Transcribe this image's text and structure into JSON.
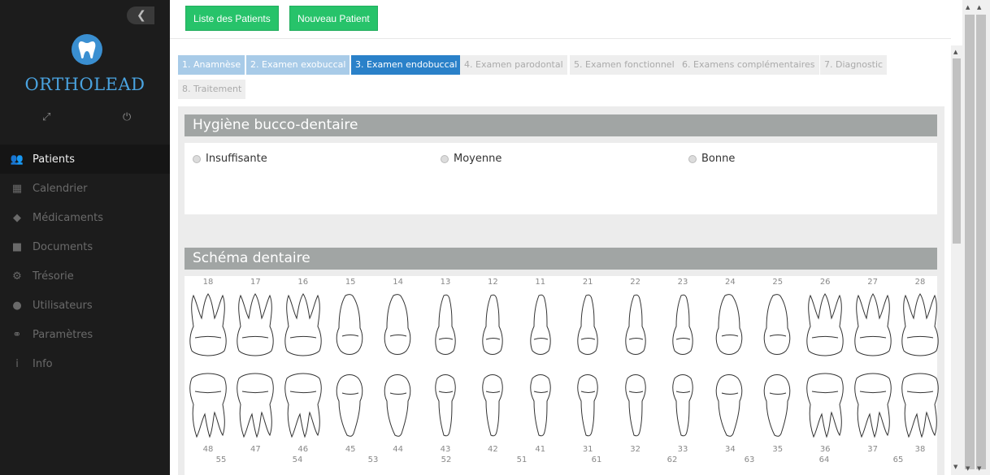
{
  "sidebar": {
    "brand": "ORTHOLEAD",
    "items": [
      {
        "label": "Patients",
        "icon": "patients-icon",
        "glyph": "👥",
        "active": true
      },
      {
        "label": "Calendrier",
        "icon": "calendar-icon",
        "glyph": "▦",
        "active": false
      },
      {
        "label": "Médicaments",
        "icon": "pill-icon",
        "glyph": "◆",
        "active": false
      },
      {
        "label": "Documents",
        "icon": "document-icon",
        "glyph": "■",
        "active": false
      },
      {
        "label": "Trésorie",
        "icon": "treasury-icon",
        "glyph": "⚙",
        "active": false
      },
      {
        "label": "Utilisateurs",
        "icon": "user-icon",
        "glyph": "●",
        "active": false
      },
      {
        "label": "Paramètres",
        "icon": "settings-icon",
        "glyph": "⚭",
        "active": false
      },
      {
        "label": "Info",
        "icon": "info-icon",
        "glyph": "i",
        "active": false
      }
    ]
  },
  "toolbar": {
    "patients_list_label": "Liste des Patients",
    "new_patient_label": "Nouveau Patient"
  },
  "steps": [
    {
      "label": "1. Anamnèse",
      "state": "done"
    },
    {
      "label": "2. Examen exobuccal",
      "state": "done"
    },
    {
      "label": "3. Examen endobuccal",
      "state": "current"
    },
    {
      "label": "4. Examen parodontal",
      "state": "todo"
    },
    {
      "label": "5. Examen fonctionnel",
      "state": "todo"
    },
    {
      "label": "6. Examens complémentaires",
      "state": "todo"
    },
    {
      "label": "7. Diagnostic",
      "state": "todo"
    },
    {
      "label": "8. Traitement",
      "state": "todo"
    }
  ],
  "hygiene": {
    "title": "Hygiène bucco-dentaire",
    "options": [
      "Insuffisante",
      "Moyenne",
      "Bonne"
    ]
  },
  "schema": {
    "title": "Schéma dentaire",
    "upper_numbers": [
      "18",
      "17",
      "16",
      "15",
      "14",
      "13",
      "12",
      "11",
      "21",
      "22",
      "23",
      "24",
      "25",
      "26",
      "27",
      "28"
    ],
    "lower_numbers": [
      "48",
      "47",
      "46",
      "45",
      "44",
      "43",
      "42",
      "41",
      "31",
      "32",
      "33",
      "34",
      "35",
      "36",
      "37",
      "38"
    ],
    "deciduous_numbers": [
      "55",
      "54",
      "53",
      "52",
      "51",
      "61",
      "62",
      "63",
      "64",
      "65"
    ]
  },
  "colors": {
    "accent_green": "#27c36a",
    "step_current": "#2a81c9",
    "step_done": "#a8cbe8",
    "brand_blue": "#4aa3e0"
  }
}
